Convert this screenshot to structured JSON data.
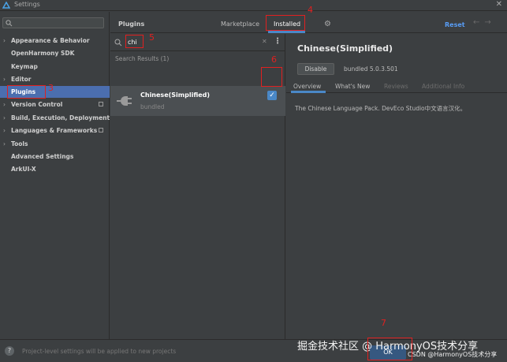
{
  "window": {
    "title": "Settings",
    "close_glyph": "✕"
  },
  "sidebar": {
    "search": {
      "icon": "search-icon"
    },
    "items": [
      {
        "label": "Appearance & Behavior",
        "expandable": true
      },
      {
        "label": "OpenHarmony SDK",
        "expandable": false
      },
      {
        "label": "Keymap",
        "expandable": false
      },
      {
        "label": "Editor",
        "expandable": true
      },
      {
        "label": "Plugins",
        "expandable": false,
        "selected": true
      },
      {
        "label": "Version Control",
        "expandable": true,
        "has_project_icon": true
      },
      {
        "label": "Build, Execution, Deployment",
        "expandable": true
      },
      {
        "label": "Languages & Frameworks",
        "expandable": true,
        "has_project_icon": true
      },
      {
        "label": "Tools",
        "expandable": true
      },
      {
        "label": "Advanced Settings",
        "expandable": false
      },
      {
        "label": "ArkUI-X",
        "expandable": false
      }
    ]
  },
  "header": {
    "title": "Plugins",
    "tabs": [
      {
        "label": "Marketplace",
        "active": false
      },
      {
        "label": "Installed",
        "active": true
      }
    ],
    "reset_label": "Reset",
    "back_glyph": "←",
    "forward_glyph": "→"
  },
  "plugin_list": {
    "search_value": "chi",
    "results_label": "Search Results (1)",
    "items": [
      {
        "name": "Chinese(Simplified)",
        "subtitle": "bundled",
        "enabled": true,
        "checkmark": "✓"
      }
    ]
  },
  "detail": {
    "title": "Chinese(Simplified)",
    "disable_label": "Disable",
    "bundled_version": "bundled 5.0.3.501",
    "tabs": [
      {
        "label": "Overview",
        "active": true,
        "dim": false
      },
      {
        "label": "What's New",
        "active": false,
        "dim": false
      },
      {
        "label": "Reviews",
        "active": false,
        "dim": true
      },
      {
        "label": "Additional Info",
        "active": false,
        "dim": true
      }
    ],
    "description": "The Chinese Language Pack. DevEco Studio中文语言汉化。"
  },
  "footer": {
    "help_label": "?",
    "message": "Project-level settings will be applied to new projects",
    "ok_label": "OK",
    "watermark_small": "CSDN @HarmonyOS技术分享"
  },
  "watermark": "掘金技术社区 @ HarmonyOS技术分享",
  "annotations": [
    "3",
    "4",
    "5",
    "6",
    "7"
  ],
  "colors": {
    "background": "#3c3f41",
    "selection": "#4b6eaf",
    "accent": "#4a88c7",
    "link": "#589df6",
    "annotation_red": "#e02020"
  }
}
